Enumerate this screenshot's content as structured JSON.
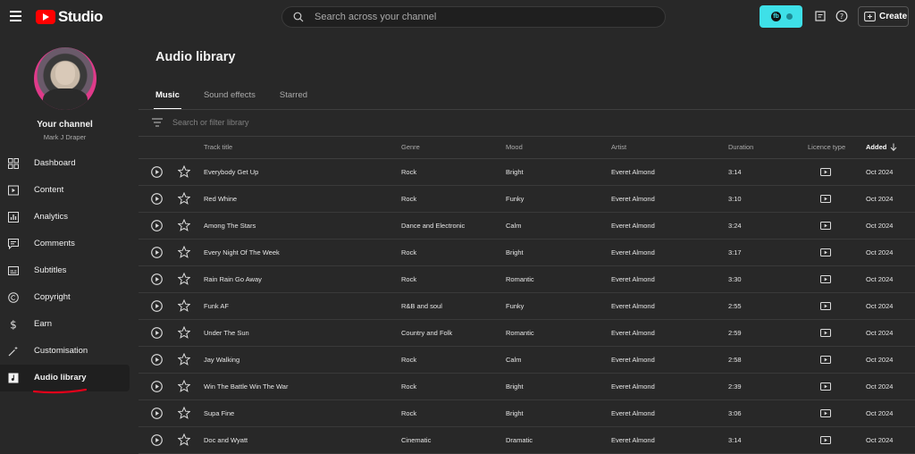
{
  "app": {
    "logo_text": "Studio"
  },
  "search": {
    "placeholder": "Search across your channel"
  },
  "header": {
    "create_label": "Create",
    "notif_badge": "fb"
  },
  "channel": {
    "title": "Your channel",
    "name": "Mark J Draper"
  },
  "sidebar": {
    "items": [
      {
        "label": "Dashboard",
        "icon": "dashboard-icon"
      },
      {
        "label": "Content",
        "icon": "content-icon"
      },
      {
        "label": "Analytics",
        "icon": "analytics-icon"
      },
      {
        "label": "Comments",
        "icon": "comments-icon"
      },
      {
        "label": "Subtitles",
        "icon": "subtitles-icon"
      },
      {
        "label": "Copyright",
        "icon": "copyright-icon"
      },
      {
        "label": "Earn",
        "icon": "dollar-icon"
      },
      {
        "label": "Customisation",
        "icon": "magic-wand-icon"
      },
      {
        "label": "Audio library",
        "icon": "audio-library-icon",
        "active": true
      }
    ]
  },
  "main": {
    "title": "Audio library",
    "tabs": [
      {
        "label": "Music",
        "active": true
      },
      {
        "label": "Sound effects"
      },
      {
        "label": "Starred"
      }
    ],
    "filter_placeholder": "Search or filter library",
    "columns": {
      "title": "Track title",
      "genre": "Genre",
      "mood": "Mood",
      "artist": "Artist",
      "duration": "Duration",
      "licence": "Licence type",
      "added": "Added"
    },
    "rows": [
      {
        "title": "Everybody Get Up",
        "genre": "Rock",
        "mood": "Bright",
        "artist": "Everet Almond",
        "duration": "3:14",
        "added": "Oct 2024"
      },
      {
        "title": "Red Whine",
        "genre": "Rock",
        "mood": "Funky",
        "artist": "Everet Almond",
        "duration": "3:10",
        "added": "Oct 2024"
      },
      {
        "title": "Among The Stars",
        "genre": "Dance and Electronic",
        "mood": "Calm",
        "artist": "Everet Almond",
        "duration": "3:24",
        "added": "Oct 2024"
      },
      {
        "title": "Every Night Of The Week",
        "genre": "Rock",
        "mood": "Bright",
        "artist": "Everet Almond",
        "duration": "3:17",
        "added": "Oct 2024"
      },
      {
        "title": "Rain Rain Go Away",
        "genre": "Rock",
        "mood": "Romantic",
        "artist": "Everet Almond",
        "duration": "3:30",
        "added": "Oct 2024"
      },
      {
        "title": "Funk AF",
        "genre": "R&B and soul",
        "mood": "Funky",
        "artist": "Everet Almond",
        "duration": "2:55",
        "added": "Oct 2024"
      },
      {
        "title": "Under The Sun",
        "genre": "Country and Folk",
        "mood": "Romantic",
        "artist": "Everet Almond",
        "duration": "2:59",
        "added": "Oct 2024"
      },
      {
        "title": "Jay Walking",
        "genre": "Rock",
        "mood": "Calm",
        "artist": "Everet Almond",
        "duration": "2:58",
        "added": "Oct 2024"
      },
      {
        "title": "Win The Battle Win The War",
        "genre": "Rock",
        "mood": "Bright",
        "artist": "Everet Almond",
        "duration": "2:39",
        "added": "Oct 2024"
      },
      {
        "title": "Supa Fine",
        "genre": "Rock",
        "mood": "Bright",
        "artist": "Everet Almond",
        "duration": "3:06",
        "added": "Oct 2024"
      },
      {
        "title": "Doc and Wyatt",
        "genre": "Cinematic",
        "mood": "Dramatic",
        "artist": "Everet Almond",
        "duration": "3:14",
        "added": "Oct 2024"
      }
    ]
  },
  "colors": {
    "accent_pill": "#3ee0e8",
    "brand_red": "#ff0000",
    "annotation_red": "#e0001a"
  }
}
